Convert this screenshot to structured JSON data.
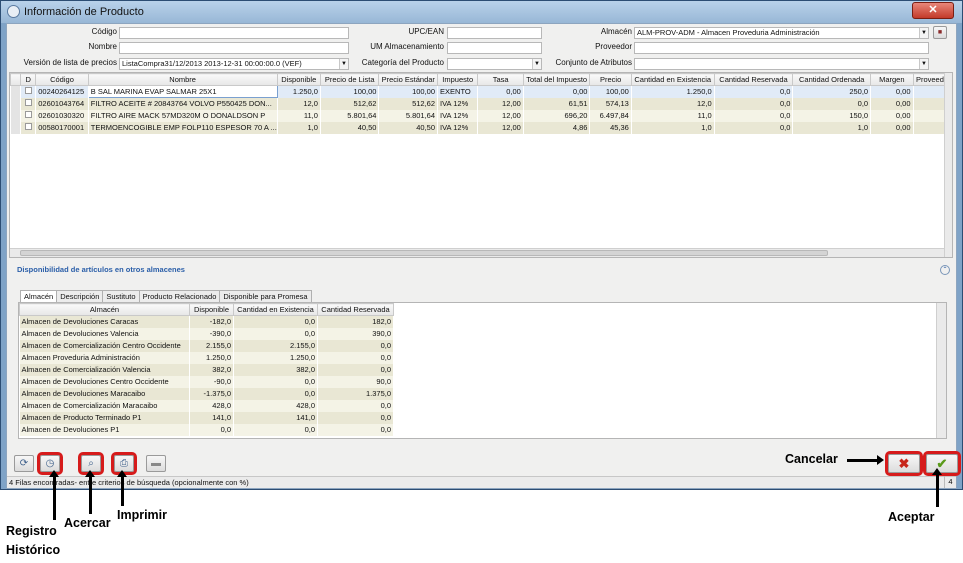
{
  "window": {
    "title": "Información de Producto",
    "close_glyph": "✕"
  },
  "form": {
    "codigo_label": "Código",
    "codigo_value": "",
    "nombre_label": "Nombre",
    "nombre_value": "",
    "version_label": "Versión de lista de precios",
    "version_value": "ListaCompra31/12/2013 2013-12-31 00:00:00.0 (VEF)",
    "upc_label": "UPC/EAN",
    "upc_value": "",
    "um_label": "UM Almacenamiento",
    "um_value": "",
    "categoria_label": "Categoría del Producto",
    "categoria_value": "",
    "almacen_label": "Almacén",
    "almacen_value": "ALM-PROV-ADM - Almacen Proveduria Administración",
    "proveedor_label": "Proveedor",
    "proveedor_value": "",
    "conjunto_label": "Conjunto de Atributos",
    "conjunto_value": ""
  },
  "products": {
    "columns": [
      "D",
      "Código",
      "Nombre",
      "Disponible",
      "Precio de Lista",
      "Precio Estándar",
      "Impuesto",
      "Tasa",
      "Total del Impuesto",
      "Precio",
      "Cantidad en Existencia",
      "Cantidad Reservada",
      "Cantidad Ordenada",
      "Margen",
      "Proveedor"
    ],
    "rows": [
      [
        "",
        "00240264125",
        "B SAL MARINA EVAP SALMAR 25X1",
        "1.250,0",
        "100,00",
        "100,00",
        "EXENTO",
        "0,00",
        "0,00",
        "100,00",
        "1.250,0",
        "0,0",
        "250,0",
        "0,00",
        ""
      ],
      [
        "",
        "02601043764",
        "FILTRO ACEITE # 20843764 VOLVO  P550425 DON...",
        "12,0",
        "512,62",
        "512,62",
        "IVA 12%",
        "12,00",
        "61,51",
        "574,13",
        "12,0",
        "0,0",
        "0,0",
        "0,00",
        ""
      ],
      [
        "",
        "02601030320",
        "FILTRO AIRE MACK 57MD320M O DONALDSON P",
        "11,0",
        "5.801,64",
        "5.801,64",
        "IVA 12%",
        "12,00",
        "696,20",
        "6.497,84",
        "11,0",
        "0,0",
        "150,0",
        "0,00",
        ""
      ],
      [
        "",
        "00580170001",
        "TERMOENCOGIBLE EMP FOLP110 ESPESOR 70 A ...",
        "1,0",
        "40,50",
        "40,50",
        "IVA 12%",
        "12,00",
        "4,86",
        "45,36",
        "1,0",
        "0,0",
        "1,0",
        "0,00",
        ""
      ]
    ]
  },
  "availability": {
    "section_title": "Disponibilidad de artículos en otros almacenes",
    "tabs": [
      "Almacén",
      "Descripción",
      "Sustituto",
      "Producto Relacionado",
      "Disponible para Promesa"
    ],
    "columns": [
      "Almacén",
      "Disponible",
      "Cantidad en Existencia",
      "Cantidad Reservada"
    ],
    "rows": [
      [
        "Almacen de Devoluciones Caracas",
        "-182,0",
        "0,0",
        "182,0"
      ],
      [
        "Almacen de Devoluciones Valencia",
        "-390,0",
        "0,0",
        "390,0"
      ],
      [
        "Almacen de Comercialización Centro Occidente",
        "2.155,0",
        "2.155,0",
        "0,0"
      ],
      [
        "Almacen Proveduria Administración",
        "1.250,0",
        "1.250,0",
        "0,0"
      ],
      [
        "Almacen de Comercialización Valencia",
        "382,0",
        "382,0",
        "0,0"
      ],
      [
        "Almacen de Devoluciones Centro Occidente",
        "-90,0",
        "0,0",
        "90,0"
      ],
      [
        "Almacen de Devoluciones Maracaibo",
        "-1.375,0",
        "0,0",
        "1.375,0"
      ],
      [
        "Almacen de Comercialización Maracaibo",
        "428,0",
        "428,0",
        "0,0"
      ],
      [
        "Almacen de Producto Terminado P1",
        "141,0",
        "141,0",
        "0,0"
      ],
      [
        "Almacen de Devoluciones P1",
        "0,0",
        "0,0",
        "0,0"
      ]
    ]
  },
  "status": {
    "text": "4 Filas encontradas- entre criterios de búsqueda (opcionalmente con %)",
    "count": "4"
  },
  "callouts": {
    "cancelar": "Cancelar",
    "aceptar": "Aceptar",
    "registro_line1": "Registro",
    "registro_line2": "Histórico",
    "acercar": "Acercar",
    "imprimir": "Imprimir"
  },
  "colors": {
    "highlight": "#d61b1b",
    "selected_row": "#e1ebf7",
    "even_row": "#f4f3e6",
    "odd_row": "#e9e7d4",
    "section_title": "#2a5ea8"
  }
}
